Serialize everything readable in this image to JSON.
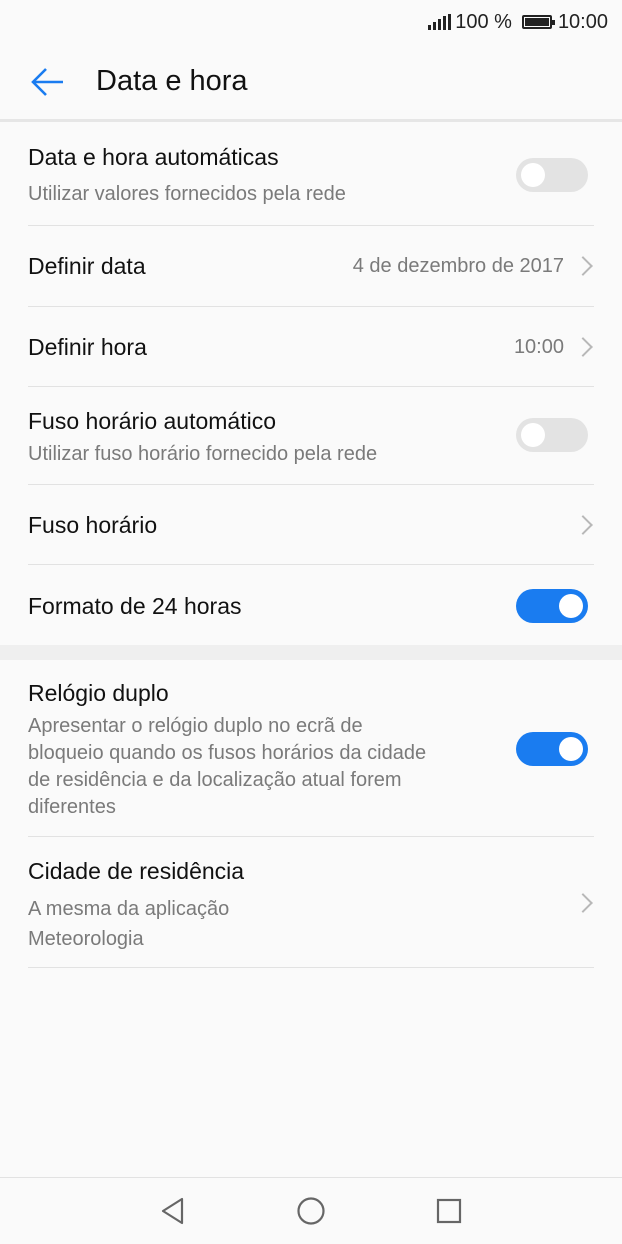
{
  "status_bar": {
    "battery": "100 %",
    "time": "10:00",
    "icons": [
      "signal-icon",
      "battery-icon"
    ]
  },
  "app_bar": {
    "title": "Data e hora",
    "back_icon": "arrow-left-icon",
    "accent_color": "#1a7cf0"
  },
  "settings": {
    "auto_datetime": {
      "title": "Data e hora automáticas",
      "subtitle": "Utilizar valores fornecidos pela rede",
      "enabled": false
    },
    "set_date": {
      "title": "Definir data",
      "value": "4 de dezembro de 2017"
    },
    "set_time": {
      "title": "Definir hora",
      "value": "10:00"
    },
    "auto_timezone": {
      "title": "Fuso horário automático",
      "subtitle": "Utilizar fuso horário fornecido pela rede",
      "enabled": false
    },
    "timezone": {
      "title": "Fuso horário"
    },
    "format_24h": {
      "title": "Formato de 24 horas",
      "enabled": true
    },
    "dual_clock": {
      "title": "Relógio duplo",
      "subtitle_lines": [
        "Apresentar o relógio duplo no ecrã de",
        "bloqueio quando os fusos horários da cidade",
        "de residência e da localização atual forem",
        "diferentes"
      ],
      "enabled": true
    },
    "home_city": {
      "title": "Cidade de residência",
      "subtitle_lines": [
        "A mesma da aplicação",
        "Meteorologia"
      ]
    }
  },
  "nav_bar": {
    "icons": [
      "back-triangle-icon",
      "home-circle-icon",
      "recents-square-icon"
    ]
  },
  "colors": {
    "toggle_on": "#1a7cf0",
    "toggle_off": "#e3e3e3"
  }
}
